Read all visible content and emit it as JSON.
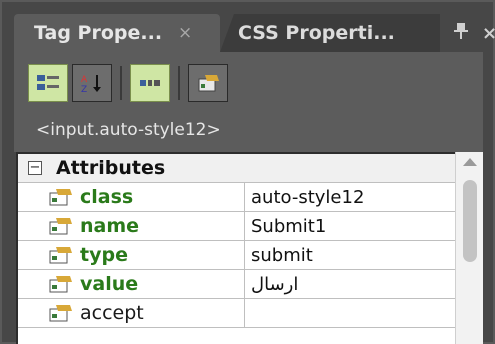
{
  "tabs": [
    {
      "label": "Tag Prope...",
      "close": "×",
      "active": true
    },
    {
      "label": "CSS Properti...",
      "active": false
    }
  ],
  "tab_tools": {
    "pin": "⊥",
    "close": "×"
  },
  "toolbar": {
    "buttons": [
      {
        "icon": "categorized-view-icon",
        "active": true
      },
      {
        "icon": "sort-alphabetical-icon",
        "active": false
      },
      {
        "icon": "show-set-properties-icon",
        "active": true
      },
      {
        "icon": "edit-attribute-icon",
        "active": false
      }
    ]
  },
  "tag_path": "<input.auto-style12>",
  "attributes": {
    "category": "Attributes",
    "collapse_symbol": "−",
    "rows": [
      {
        "name": "class",
        "value": "auto-style12",
        "set": true
      },
      {
        "name": "name",
        "value": "Submit1",
        "set": true
      },
      {
        "name": "type",
        "value": "submit",
        "set": true
      },
      {
        "name": "value",
        "value": "ارسال",
        "set": true
      },
      {
        "name": "accept",
        "value": "",
        "set": false
      }
    ]
  },
  "colors": {
    "set_attribute": "#2a7a1a",
    "active_button": "#cfe6a4"
  }
}
